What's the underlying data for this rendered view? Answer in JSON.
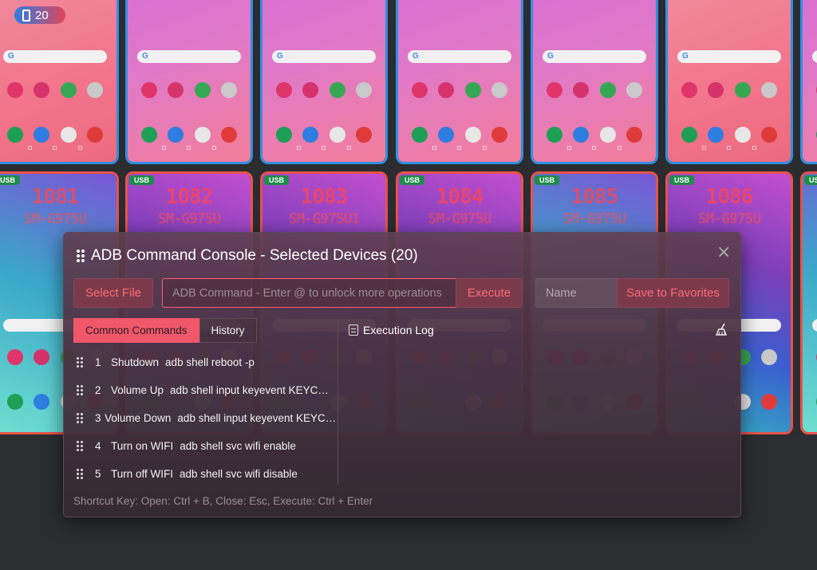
{
  "device_count_badge": "20",
  "devices_top": [
    {
      "screen": "coral"
    },
    {
      "screen": "pink"
    },
    {
      "screen": "pink"
    },
    {
      "screen": "pink"
    },
    {
      "screen": "pink"
    },
    {
      "screen": "coral"
    },
    {
      "screen": "pink"
    }
  ],
  "devices_bottom": [
    {
      "tag": "USB",
      "number": "1081",
      "model": "SM-G975U",
      "screen": "teal"
    },
    {
      "tag": "USB",
      "number": "1082",
      "model": "SM-G975U",
      "screen": "wave"
    },
    {
      "tag": "USB",
      "number": "1083",
      "model": "SM-G975U1",
      "screen": "wave"
    },
    {
      "tag": "USB",
      "number": "1084",
      "model": "SM-G975U",
      "screen": "wave"
    },
    {
      "tag": "USB",
      "number": "1085",
      "model": "SM-G975U",
      "screen": "teal"
    },
    {
      "tag": "USB",
      "number": "1086",
      "model": "SM-G975U",
      "screen": "wave"
    },
    {
      "tag": "USB",
      "number": "",
      "model": "",
      "screen": "teal"
    }
  ],
  "console": {
    "title": "ADB Command Console - Selected Devices (20)",
    "select_file_label": "Select File",
    "command_placeholder": "ADB Command - Enter @ to unlock more operations",
    "execute_label": "Execute",
    "name_placeholder": "Name",
    "save_favorites_label": "Save to Favorites",
    "tabs": [
      {
        "label": "Common Commands",
        "active": true
      },
      {
        "label": "History",
        "active": false
      }
    ],
    "commands": [
      {
        "index": "1",
        "name": "Shutdown",
        "command": "adb shell reboot -p"
      },
      {
        "index": "2",
        "name": "Volume Up",
        "command": "adb shell input keyevent KEYCODE_VOLUME_UP"
      },
      {
        "index": "3",
        "name": "Volume Down",
        "command": "adb shell input keyevent KEYCODE_VOLUME_DOWN"
      },
      {
        "index": "4",
        "name": "Turn on WIFI",
        "command": "adb shell svc wifi enable"
      },
      {
        "index": "5",
        "name": "Turn off WIFI",
        "command": "adb shell svc wifi disable"
      }
    ],
    "log_title": "Execution Log",
    "shortcut_text": "Shortcut Key: Open: Ctrl + B, Close: Esc, Execute: Ctrl + Enter"
  },
  "colors": {
    "accent": "#f0586a",
    "top_border": "#2f8ee0",
    "bottom_border": "#e8524a",
    "usb_tag": "#1e8c4a"
  }
}
